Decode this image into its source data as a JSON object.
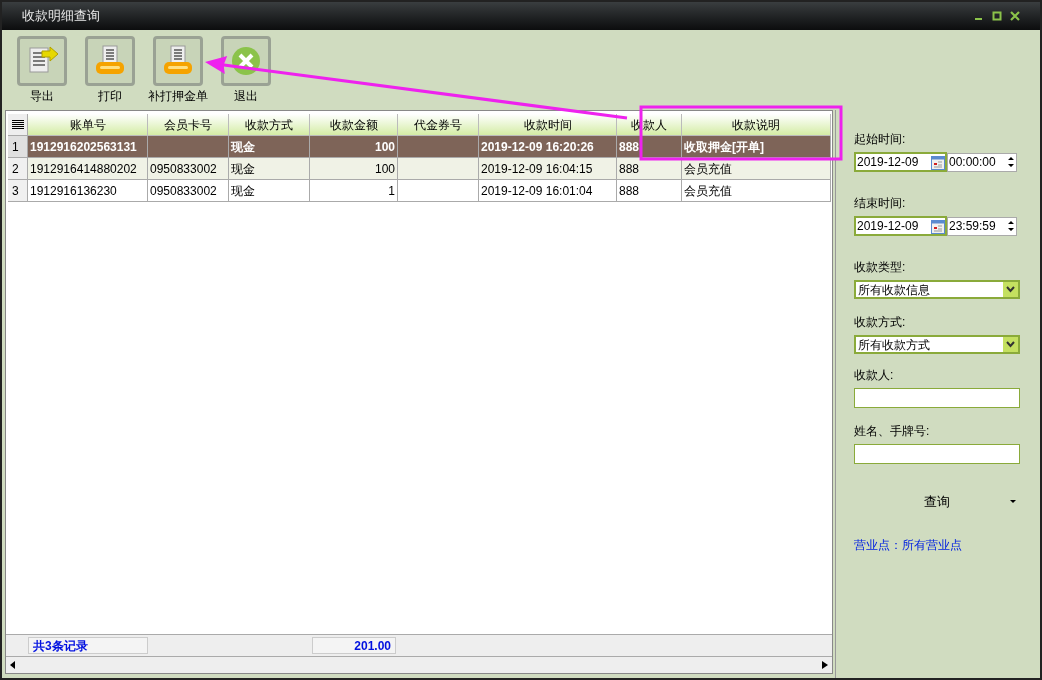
{
  "window": {
    "title": "收款明细查询"
  },
  "toolbar": {
    "buttons": [
      {
        "label": "导出",
        "kind": "export"
      },
      {
        "label": "打印",
        "kind": "print"
      },
      {
        "label": "补打押金单",
        "kind": "print"
      },
      {
        "label": "退出",
        "kind": "exit"
      }
    ]
  },
  "table": {
    "columns": [
      "账单号",
      "会员卡号",
      "收款方式",
      "收款金额",
      "代金券号",
      "收款时间",
      "收款人",
      "收款说明"
    ],
    "rows": [
      {
        "index": "1",
        "selected": true,
        "cells": [
          "1912916202563131",
          "",
          "现金",
          "100",
          "",
          "2019-12-09 16:20:26",
          "888",
          "收取押金[开单]"
        ]
      },
      {
        "index": "2",
        "selected": false,
        "cells": [
          "1912916414880202",
          "0950833002",
          "现金",
          "100",
          "",
          "2019-12-09 16:04:15",
          "888",
          "会员充值"
        ]
      },
      {
        "index": "3",
        "selected": false,
        "cells": [
          "1912916136230",
          "0950833002",
          "现金",
          "1",
          "",
          "2019-12-09 16:01:04",
          "888",
          "会员充值"
        ]
      }
    ],
    "footer": {
      "count": "共3条记录",
      "total": "201.00"
    }
  },
  "filters": {
    "start": {
      "label": "起始时间:",
      "date": "2019-12-09",
      "time": "00:00:00"
    },
    "end": {
      "label": "结束时间:",
      "date": "2019-12-09",
      "time": "23:59:59"
    },
    "payment_type": {
      "label": "收款类型:",
      "value": "所有收款信息"
    },
    "payment_method": {
      "label": "收款方式:",
      "value": "所有收款方式"
    },
    "payee": {
      "label": "收款人:"
    },
    "name_tag": {
      "label": "姓名、手牌号:"
    },
    "query_button": "查询",
    "branch": "营业点：所有营业点"
  }
}
